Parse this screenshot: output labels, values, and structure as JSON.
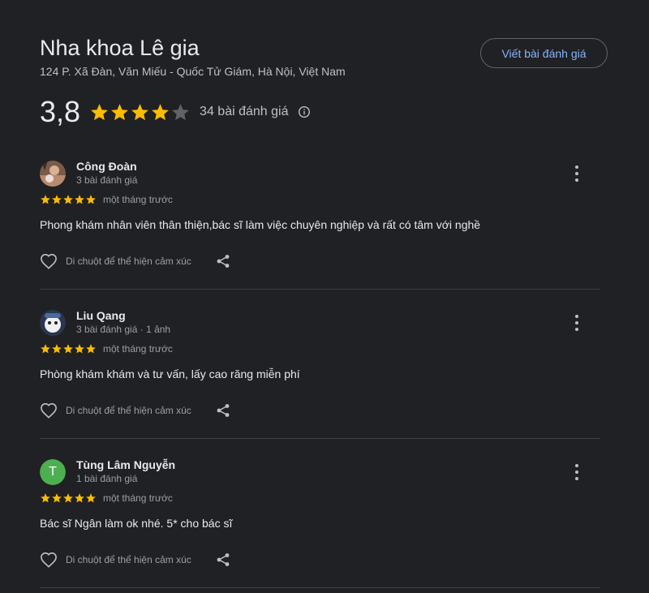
{
  "place": {
    "name": "Nha khoa Lê gia",
    "address": "124 P. Xã Đàn, Văn Miếu - Quốc Tử Giám, Hà Nội, Việt Nam",
    "rating": "3,8",
    "rating_value": 3.8,
    "review_count": "34 bài đánh giá",
    "write_review_label": "Viết bài đánh giá"
  },
  "colors": {
    "star": "#fbbc04",
    "star_empty": "#5f6368",
    "link": "#8ab4f8",
    "avatar_t": "#4caf50"
  },
  "reviews": [
    {
      "name": "Công Đoàn",
      "meta": "3 bài đánh giá",
      "stars": 5,
      "time": "một tháng trước",
      "text": "Phong khám nhân viên thân thiện,bác sĩ làm việc chuyên nghiệp và rất có tâm với nghề",
      "react_label": "Di chuột để thể hiện cảm xúc"
    },
    {
      "name": "Liu Qang",
      "meta": "3 bài đánh giá · 1 ảnh",
      "stars": 5,
      "time": "một tháng trước",
      "text": "Phòng khám khám và tư vấn, lấy cao răng miễn phí",
      "react_label": "Di chuột để thể hiện cảm xúc"
    },
    {
      "name": "Tùng Lâm Nguyễn",
      "avatar_letter": "T",
      "meta": "1 bài đánh giá",
      "stars": 5,
      "time": "một tháng trước",
      "text": "Bác sĩ Ngân làm ok nhé. 5* cho bác sĩ",
      "react_label": "Di chuột để thể hiện cảm xúc"
    }
  ]
}
